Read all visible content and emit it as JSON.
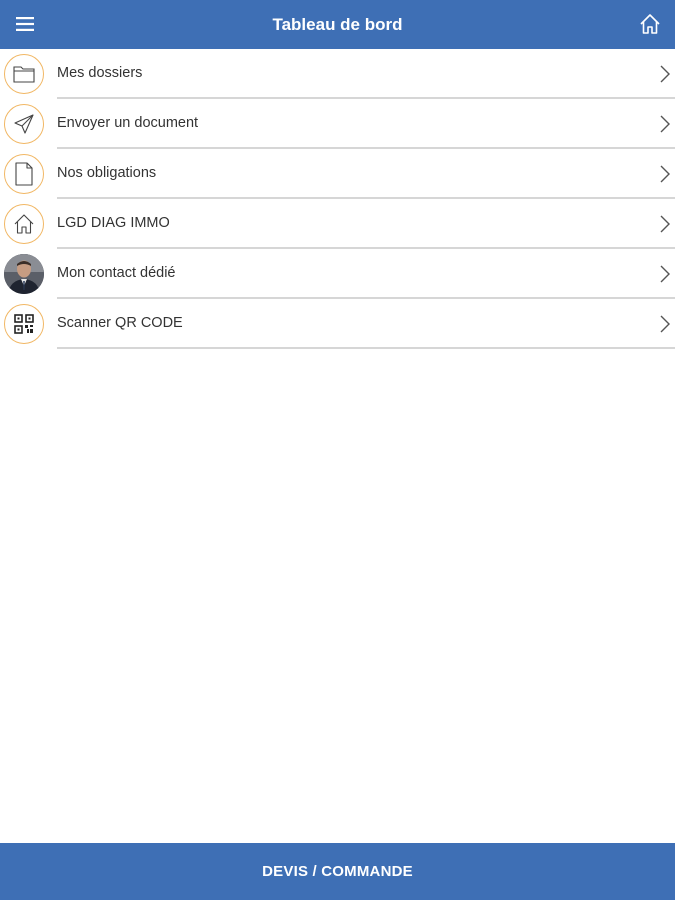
{
  "header": {
    "title": "Tableau de bord",
    "menu_icon": "hamburger-menu-icon",
    "home_icon": "home-icon"
  },
  "menu": {
    "items": [
      {
        "label": "Mes dossiers",
        "icon": "folder-icon"
      },
      {
        "label": "Envoyer un document",
        "icon": "paper-plane-icon"
      },
      {
        "label": "Nos obligations",
        "icon": "document-icon"
      },
      {
        "label": "LGD DIAG IMMO",
        "icon": "house-icon"
      },
      {
        "label": "Mon contact dédié",
        "icon": "contact-avatar"
      },
      {
        "label": "Scanner QR CODE",
        "icon": "qr-code-icon"
      }
    ]
  },
  "footer": {
    "button_label": "DEVIS / COMMANDE"
  },
  "colors": {
    "primary": "#3e6fb5",
    "icon_ring": "#f1b764",
    "separator": "#d6d6d6",
    "text": "#333333"
  }
}
